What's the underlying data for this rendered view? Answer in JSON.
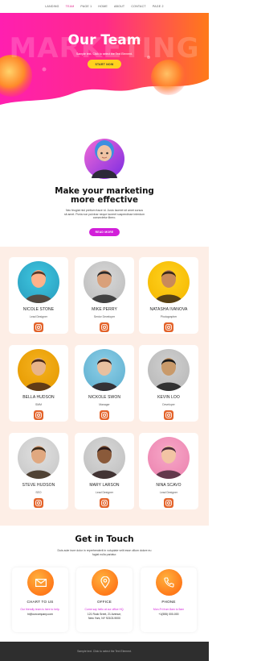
{
  "nav": {
    "items": [
      "LANDING",
      "TEAM",
      "PAGE 1",
      "HOME",
      "ABOUT",
      "CONTACT",
      "PAGE 2"
    ],
    "active": "TEAM"
  },
  "hero": {
    "bg_word": "MARKETING",
    "title": "Our Team",
    "subtitle": "Sample text. Click to select the Text Element.",
    "cta": "START NOW"
  },
  "intro": {
    "title_line1": "Make your marketing",
    "title_line2": "more effective",
    "text": "Nec feugiat nisl pretium fusce id. Justo laoreet sit amet cursus sit amet. Porta non pulvinar neque laoreet suspendisse interdum consectetur libero.",
    "button": "READ MORE"
  },
  "team": {
    "members": [
      {
        "name": "NICOLE STONE",
        "role": "Lead Designer"
      },
      {
        "name": "MIKE PERRY",
        "role": "Senior Developer"
      },
      {
        "name": "NATASHA IVANOVA",
        "role": "Photographer"
      },
      {
        "name": "BELLA HUDSON",
        "role": "SMM"
      },
      {
        "name": "NICKOLE SWON",
        "role": "Manager"
      },
      {
        "name": "KEVIN LOO",
        "role": "Developer"
      },
      {
        "name": "STEVE HUDSON",
        "role": "SEO"
      },
      {
        "name": "MARY LARSON",
        "role": "Lead Designer"
      },
      {
        "name": "NINA SCAVO",
        "role": "Lead Designer"
      }
    ]
  },
  "contact": {
    "title": "Get in Touch",
    "text": "Duis aute irure dolor in reprehenderit in voluptate velit esse cillum dolore eu fugiat nulla pariatur.",
    "cards": [
      {
        "icon": "mail-icon",
        "title": "CHART TO US",
        "line1": "Our friendly team is here to help.",
        "line2": "hi@ourcompany.com",
        "line3": ""
      },
      {
        "icon": "location-icon",
        "title": "OFFICE",
        "line1": "Come say hello at our office HQ.",
        "line2": "121 Rock Sreet, 21 Avenue,",
        "line3": "New York, NY 92103-9000"
      },
      {
        "icon": "phone-icon",
        "title": "PHONE",
        "line1": "Mon-Fri from 8am to 5am",
        "line2": "+1(555) 000-000",
        "line3": ""
      }
    ]
  },
  "footer": {
    "text": "Sample text. Click to select the Text Element."
  },
  "colors": {
    "accent_pink": "#d21fd9",
    "hero_orange": "#ff7a1a",
    "cta_yellow": "#ffd21f",
    "team_bg": "#fdeee6",
    "footer_bg": "#2e2e2e"
  }
}
